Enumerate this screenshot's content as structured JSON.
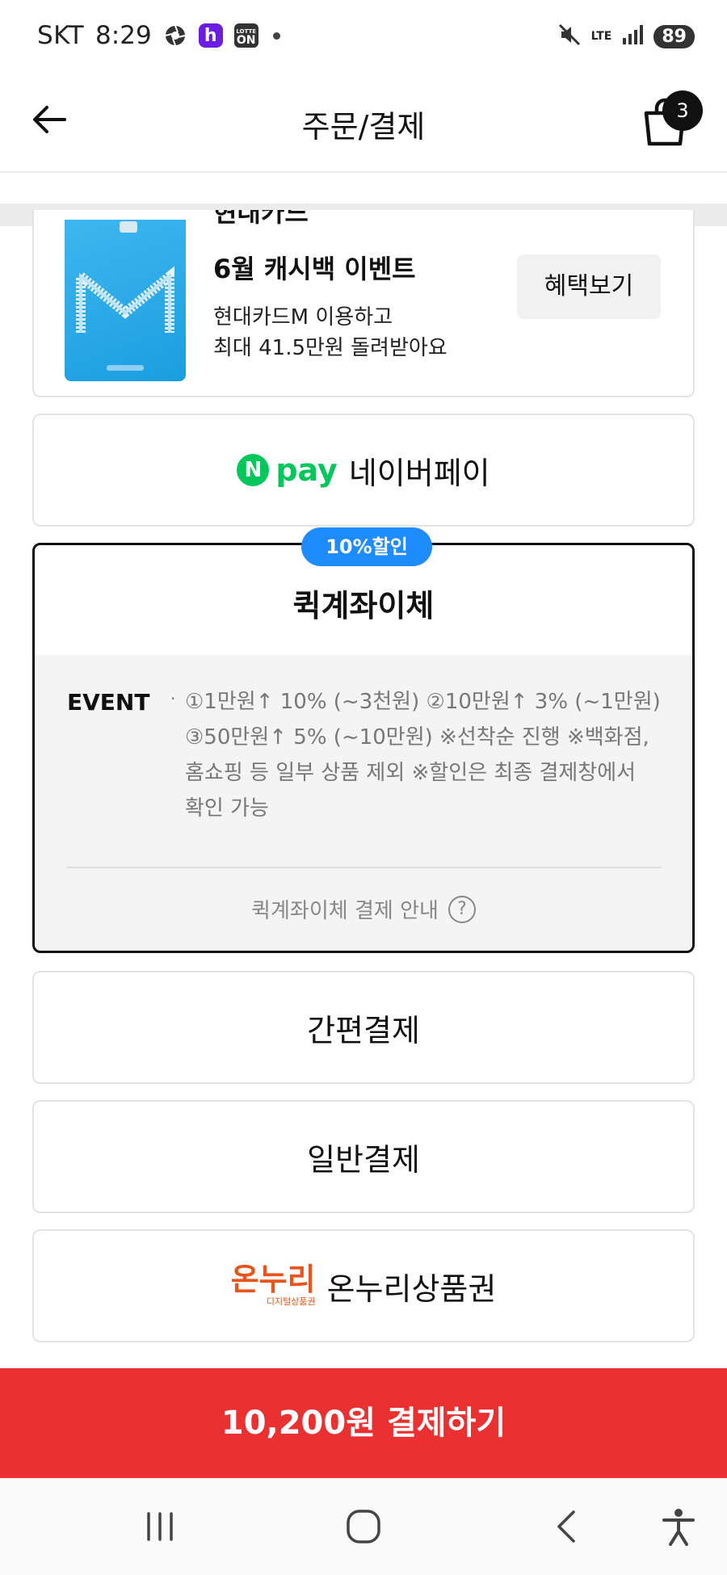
{
  "status_bar": {
    "carrier": "SKT",
    "time": "8:29",
    "app_icons": [
      "camera-shutter-icon",
      "h-app-icon",
      "lotte-on-icon"
    ],
    "lotte_on_small": "LOTTE",
    "lotte_on_big": "ON",
    "h_icon_letter": "h",
    "network": "LTE",
    "battery": "89"
  },
  "header": {
    "title": "주문/결제",
    "cart_count": "3"
  },
  "promo": {
    "partial_title": "현대카드",
    "title": "6월 캐시백 이벤트",
    "desc_line1": "현대카드M 이용하고",
    "desc_line2": "최대 41.5만원 돌려받아요",
    "benefit_button": "혜택보기"
  },
  "payment_options": {
    "naver_pay": {
      "logo_n": "N",
      "logo_text": "pay",
      "label": "네이버페이"
    },
    "quick_transfer": {
      "badge": "10%할인",
      "title": "퀵계좌이체",
      "event_label": "EVENT",
      "event_bullet": "·",
      "event_text": "①1만원↑ 10% (~3천원) ②10만원↑ 3% (~1만원) ③50만원↑ 5% (~10만원) ※선착순 진행 ※백화점,홈쇼핑 등 일부 상품 제외 ※할인은 최종 결제창에서 확인 가능",
      "guide_link": "퀵계좌이체 결제 안내",
      "help_symbol": "?"
    },
    "easy_pay": {
      "label": "간편결제"
    },
    "general_pay": {
      "label": "일반결제"
    },
    "onnuri": {
      "logo_main": "온누리",
      "logo_sub": "디지털상품권",
      "label": "온누리상품권"
    }
  },
  "pay_button": {
    "label": "10,200원 결제하기"
  },
  "colors": {
    "accent_red": "#ea3030",
    "naver_green": "#03c75a",
    "badge_blue": "#1e8bff",
    "onnuri_orange": "#e8541b"
  }
}
